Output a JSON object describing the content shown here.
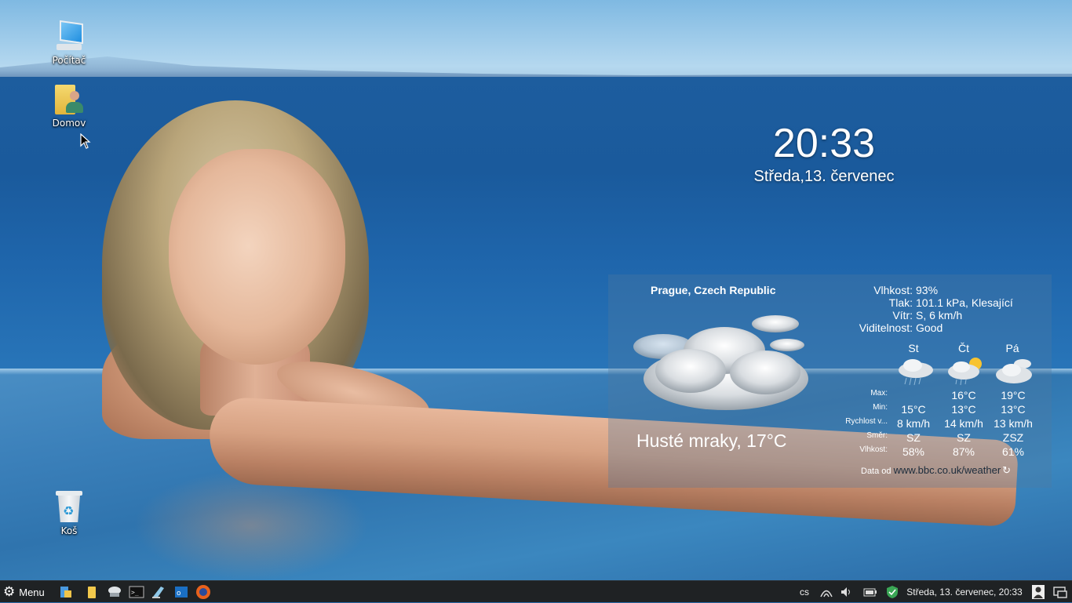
{
  "desktop": {
    "icons": [
      {
        "label": "Počítač",
        "icon": "computer-icon"
      },
      {
        "label": "Domov",
        "icon": "home-folder-icon"
      },
      {
        "label": "Koš",
        "icon": "trash-icon"
      }
    ]
  },
  "clock": {
    "time": "20:33",
    "date": "Středa,13. červenec"
  },
  "weather": {
    "location": "Prague, Czech Republic",
    "current": "Husté mraky, 17°C",
    "details": [
      {
        "key": "Vlhkost:",
        "value": "93%"
      },
      {
        "key": "Tlak:",
        "value": "101.1 kPa, Klesající"
      },
      {
        "key": "Vítr:",
        "value": "S, 6 km/h"
      },
      {
        "key": "Viditelnost:",
        "value": "Good"
      }
    ],
    "forecast": {
      "days": [
        "St",
        "Čt",
        "Pá"
      ],
      "row_labels": [
        "Max:",
        "Min:",
        "Rychlost v...",
        "Směr:",
        "Vlhkost:"
      ],
      "max": [
        "",
        "16°C",
        "19°C"
      ],
      "min": [
        "15°C",
        "13°C",
        "13°C"
      ],
      "wind_speed": [
        "8 km/h",
        "14 km/h",
        "13 km/h"
      ],
      "wind_dir": [
        "SZ",
        "SZ",
        "ZSZ"
      ],
      "humidity": [
        "58%",
        "87%",
        "61%"
      ],
      "icons": [
        "rain-cloud-icon",
        "sun-cloud-icon",
        "cloud-icon"
      ]
    },
    "source_label": "Data od",
    "source_link": "www.bbc.co.uk/weather"
  },
  "taskbar": {
    "menu_label": "Menu",
    "launchers": [
      "file-manager-icon",
      "files-icon",
      "network-icon",
      "terminal-icon",
      "notes-icon",
      "outlook-icon",
      "firefox-icon"
    ],
    "keyboard_layout": "cs",
    "datetime": "Středa, 13. červenec, 20:33"
  },
  "colors": {
    "taskbar_bg": "#1f2224",
    "sea": "#1d5d9e",
    "sky": "#9fcbe9"
  }
}
